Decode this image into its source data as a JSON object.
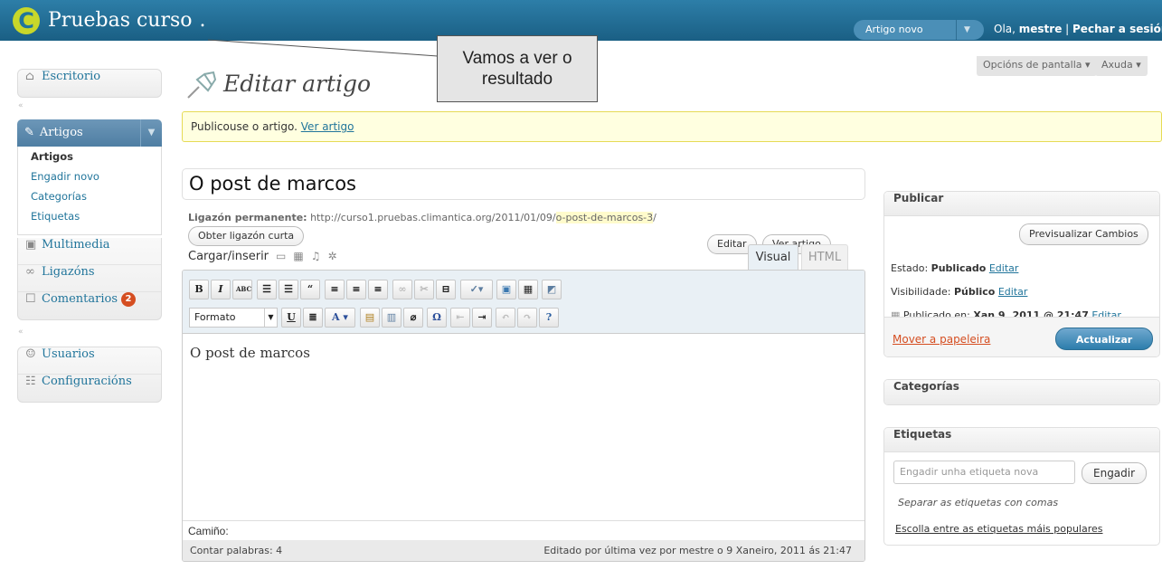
{
  "header": {
    "logo_letter": "C",
    "site_title": "Pruebas curso",
    "site_title_suffix": ".",
    "new_post_label": "Artigo novo",
    "greeting_prefix": "Ola, ",
    "user_name": "mestre",
    "separator": " | ",
    "logout_label": "Pechar a sesión"
  },
  "callout": {
    "line1": "Vamos a ver o",
    "line2": "resultado"
  },
  "screen_options": {
    "label": "Opcións de pantalla ▾",
    "help": "Axuda ▾"
  },
  "sidebar": {
    "dashboard": "Escritorio",
    "posts": "Artigos",
    "posts_sub": [
      "Artigos",
      "Engadir novo",
      "Categorías",
      "Etiquetas"
    ],
    "media": "Multimedia",
    "links": "Ligazóns",
    "comments": "Comentarios",
    "comments_count": "2",
    "users": "Usuarios",
    "settings": "Configuracións"
  },
  "page": {
    "title": "Editar artigo",
    "notice_text": "Publicouse o artigo. ",
    "notice_link": "Ver artigo",
    "post_title": "O post de marcos",
    "permalink_label": "Ligazón permanente:",
    "permalink_base": " http://curso1.pruebas.climantica.org/2011/01/09/",
    "permalink_slug": "o-post-de-marcos-3",
    "permalink_end": "/",
    "edit_button": "Editar",
    "view_button": "Ver artigo",
    "shortlink_button": "Obter ligazón curta",
    "upload_label": "Cargar/inserir"
  },
  "editor": {
    "tab_visual": "Visual",
    "tab_html": "HTML",
    "format_select": "Formato",
    "content": "O post de marcos",
    "path_label": "Camiño:",
    "word_count": "Contar palabras: 4",
    "last_edited": "Editado por última vez por mestre o 9 Xaneiro, 2011 ás 21:47"
  },
  "publish": {
    "title": "Publicar",
    "preview_button": "Previsualizar Cambios",
    "status_label": "Estado: ",
    "status_value": "Publicado",
    "visibility_label": "Visibilidade: ",
    "visibility_value": "Público",
    "published_label": "Publicado en: ",
    "published_value": "Xan 9, 2011 @ 21:47",
    "edit_link": "Editar",
    "trash_link": "Mover a papeleira",
    "update_button": "Actualizar"
  },
  "categories": {
    "title": "Categorías"
  },
  "tags": {
    "title": "Etiquetas",
    "input_placeholder": "Engadir unha etiqueta nova",
    "add_button": "Engadir",
    "hint": "Separar as etiquetas con comas",
    "popular_link": "Escolla entre as etiquetas máis populares"
  },
  "colors": {
    "header_bg": "#21759b",
    "link": "#21759b",
    "notice_bg": "#ffffe0",
    "badge": "#d54e21",
    "logo": "#c8d72a"
  }
}
